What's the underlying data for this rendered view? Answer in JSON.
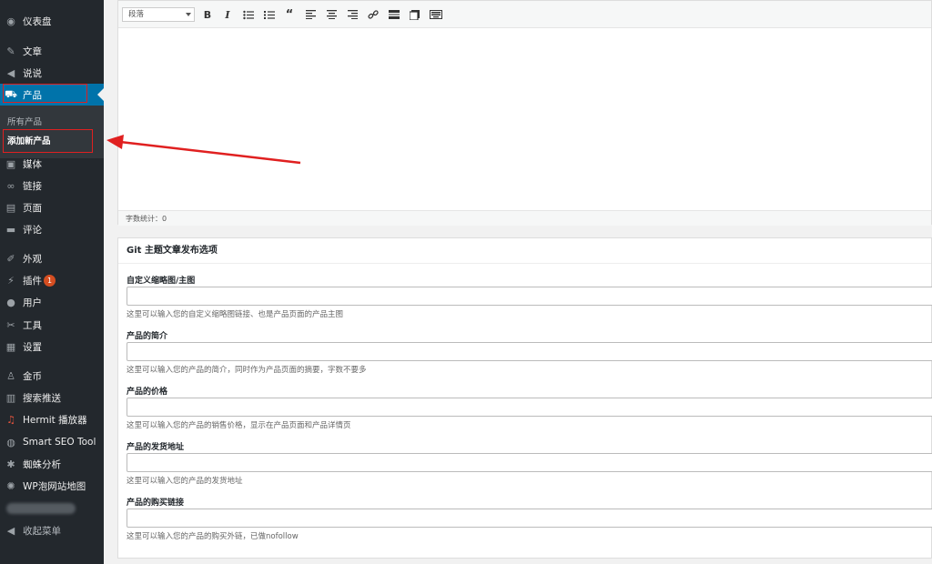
{
  "sidebar": {
    "items": [
      {
        "label": "仪表盘",
        "icon": "dashboard-icon"
      },
      {
        "label": "文章",
        "icon": "pin-icon"
      },
      {
        "label": "说说",
        "icon": "megaphone-icon"
      },
      {
        "label": "产品",
        "icon": "cart-icon"
      },
      {
        "label": "媒体",
        "icon": "media-icon"
      },
      {
        "label": "链接",
        "icon": "link-icon"
      },
      {
        "label": "页面",
        "icon": "page-icon"
      },
      {
        "label": "评论",
        "icon": "comment-icon"
      },
      {
        "label": "外观",
        "icon": "brush-icon"
      },
      {
        "label": "插件",
        "icon": "plugin-icon",
        "badge": "1"
      },
      {
        "label": "用户",
        "icon": "user-icon"
      },
      {
        "label": "工具",
        "icon": "wrench-icon"
      },
      {
        "label": "设置",
        "icon": "settings-icon"
      },
      {
        "label": "金币",
        "icon": "coin-icon"
      },
      {
        "label": "搜索推送",
        "icon": "push-icon"
      },
      {
        "label": "Hermit 播放器",
        "icon": "music-icon"
      },
      {
        "label": "Smart SEO Tool",
        "icon": "seo-icon"
      },
      {
        "label": "蜘蛛分析",
        "icon": "spider-icon"
      },
      {
        "label": "WP泡网站地图",
        "icon": "sitemap-icon"
      },
      {
        "label": "收起菜单",
        "icon": "collapse-icon"
      }
    ],
    "submenu": [
      "所有产品",
      "添加新产品"
    ]
  },
  "editor": {
    "format_select": "段落",
    "word_count": "字数统计：0",
    "toolbar": [
      "bold-icon",
      "italic-icon",
      "bullet-list-icon",
      "numbered-list-icon",
      "blockquote-icon",
      "align-left-icon",
      "align-center-icon",
      "align-right-icon",
      "insert-link-icon",
      "read-more-icon",
      "toolbar-toggle-icon",
      "keyboard-icon"
    ]
  },
  "metabox": {
    "title": "Git 主题文章发布选项",
    "fields": [
      {
        "label": "自定义缩略图/主图",
        "desc": "这里可以输入您的自定义缩略图链接、也是产品页面的产品主图"
      },
      {
        "label": "产品的简介",
        "desc": "这里可以输入您的产品的简介，同时作为产品页面的摘要，字数不要多"
      },
      {
        "label": "产品的价格",
        "desc": "这里可以输入您的产品的销售价格，显示在产品页面和产品详情页"
      },
      {
        "label": "产品的发货地址",
        "desc": "这里可以输入您的产品的发货地址"
      },
      {
        "label": "产品的购买链接",
        "desc": "这里可以输入您的产品的购买外链，已做nofollow"
      }
    ]
  },
  "colors": {
    "sidebar_bg": "#23282d",
    "accent": "#0073aa",
    "annotation": "#e02020"
  }
}
